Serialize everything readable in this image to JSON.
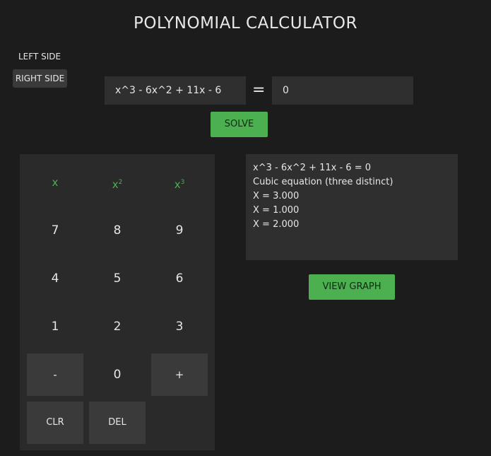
{
  "title": "POLYNOMIAL CALCULATOR",
  "sides": {
    "left_label": "LEFT SIDE",
    "right_label": "RIGHT SIDE"
  },
  "equation": {
    "left_value": "x^3 - 6x^2 + 11x - 6",
    "equals_sign": "=",
    "right_value": "0"
  },
  "buttons": {
    "solve_label": "SOLVE",
    "view_graph_label": "VIEW GRAPH"
  },
  "keypad": {
    "var_x": "x",
    "var_x2_base": "x",
    "var_x2_exp": "2",
    "var_x3_base": "x",
    "var_x3_exp": "3",
    "k7": "7",
    "k8": "8",
    "k9": "9",
    "k4": "4",
    "k5": "5",
    "k6": "6",
    "k1": "1",
    "k2": "2",
    "k3": "3",
    "minus": "-",
    "k0": "0",
    "plus": "+",
    "clear": "CLR",
    "delete": "DEL"
  },
  "result": {
    "lines": [
      "x^3 - 6x^2 + 11x - 6 = 0",
      "Cubic equation (three distinct)",
      "X = 3.000",
      "X = 1.000",
      "X = 2.000"
    ]
  },
  "colors": {
    "background": "#1c1c1c",
    "panel": "#2a2a2a",
    "accent_green": "#4caf50"
  }
}
